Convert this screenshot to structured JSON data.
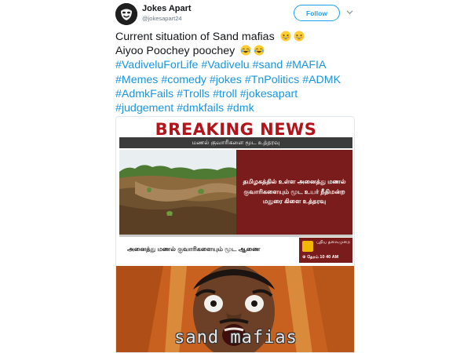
{
  "tweet": {
    "author": {
      "display_name": "Jokes Apart",
      "handle": "@jokesapart24",
      "avatar_icon": "mask-avatar-icon"
    },
    "follow_label": "Follow",
    "more_icon": "chevron-down-icon",
    "text": {
      "line1": "Current situation of Sand mafias",
      "line2": "Aiyoo Poochey poochey",
      "line1_emoji": [
        "grinning-squint-emoji",
        "grinning-squint-emoji"
      ],
      "line2_emoji": [
        "tears-of-joy-emoji",
        "tears-of-joy-emoji"
      ],
      "hashtags": [
        [
          "#VadiveluForLife",
          "#Vadivelu",
          "#sand",
          "#MAFIA"
        ],
        [
          "#Memes",
          "#comedy",
          "#jokes",
          "#TnPolitics",
          "#ADMK"
        ],
        [
          "#AdmkFails",
          "#Trolls",
          "#troll",
          "#jokesapart"
        ],
        [
          "#judgement",
          "#dmkfails",
          "#dmk"
        ]
      ]
    },
    "media": {
      "news": {
        "headline": "BREAKING NEWS",
        "subheadline": "மணல் குவாரிகளை மூட உத்தரவு",
        "panel_text": "தமிழகத்தில் உள்ள அனைத்து மணல் குவாரிகளையும் மூட உயர் நீதிமன்ற மதுரை கிளை உத்தரவு",
        "bottom_text": "அனைத்து மணல் குவாரிகளையும் மூட ஆணை",
        "channel_name": "புதிய தலைமுறை",
        "time": "⊕ தேரம் 10 40 AM"
      },
      "meme_caption": "sand mafias"
    },
    "colors": {
      "hashtag": "#1b95e0",
      "follow": "#1da1f2",
      "breaking_red": "#b3141b",
      "panel_red": "#7b1c1c"
    }
  }
}
